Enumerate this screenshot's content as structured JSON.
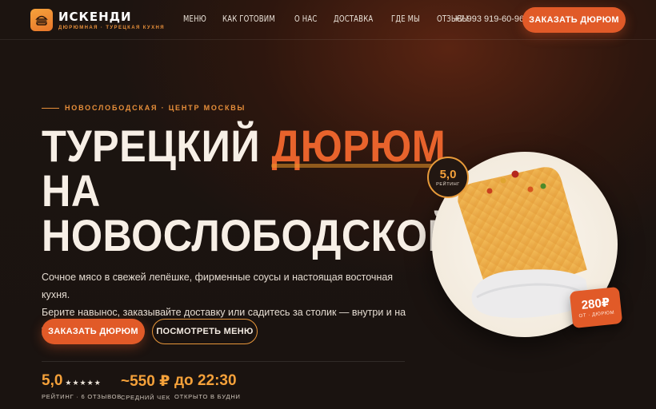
{
  "nav": {
    "brand": "ИСКЕНДИ",
    "tagline": "ДЮРЮМНАЯ · ТУРЕЦКАЯ КУХНЯ",
    "menu": [
      "МЕНЮ",
      "КАК ГОТОВИМ",
      "О НАС",
      "ДОСТАВКА",
      "ГДЕ МЫ",
      "ОТЗЫВЫ"
    ],
    "phone": "+7 993 919-60-96",
    "cta": "ЗАКАЗАТЬ ДЮРЮМ"
  },
  "hero": {
    "eyebrow": "НОВОСЛОБОДСКАЯ · ЦЕНТР МОСКВЫ",
    "title_part1": "ТУРЕЦКИЙ ",
    "title_accent": "ДЮРЮМ",
    "title_line2": "НА",
    "title_line3": "НОВОСЛОБОДСКОЙ",
    "lead_line1": "Сочное мясо в свежей лепёшке, фирменные соусы и настоящая восточная кухня.",
    "lead_line2": "Берите навынос, заказывайте доставку или садитесь за столик — внутри и на улице.",
    "primary_button": "ЗАКАЗАТЬ ДЮРЮМ",
    "secondary_button": "ПОСМОТРЕТЬ МЕНЮ"
  },
  "stats": [
    {
      "value": "5,0",
      "stars": "★★★★★",
      "label": "РЕЙТИНГ · 6 ОТЗЫВОВ"
    },
    {
      "value": "~550 ₽",
      "label": "СРЕДНИЙ ЧЕК"
    },
    {
      "value": "до 22:30",
      "label": "ОТКРЫТО В БУДНИ"
    }
  ],
  "badges": {
    "rating_value": "5,0",
    "rating_label": "РЕЙТИНГ",
    "price_value": "280₽",
    "price_label": "ОТ · ДЮРЮМ"
  },
  "colors": {
    "accent": "#e15a28",
    "gold": "#f5a13a",
    "background": "#1a1310"
  }
}
